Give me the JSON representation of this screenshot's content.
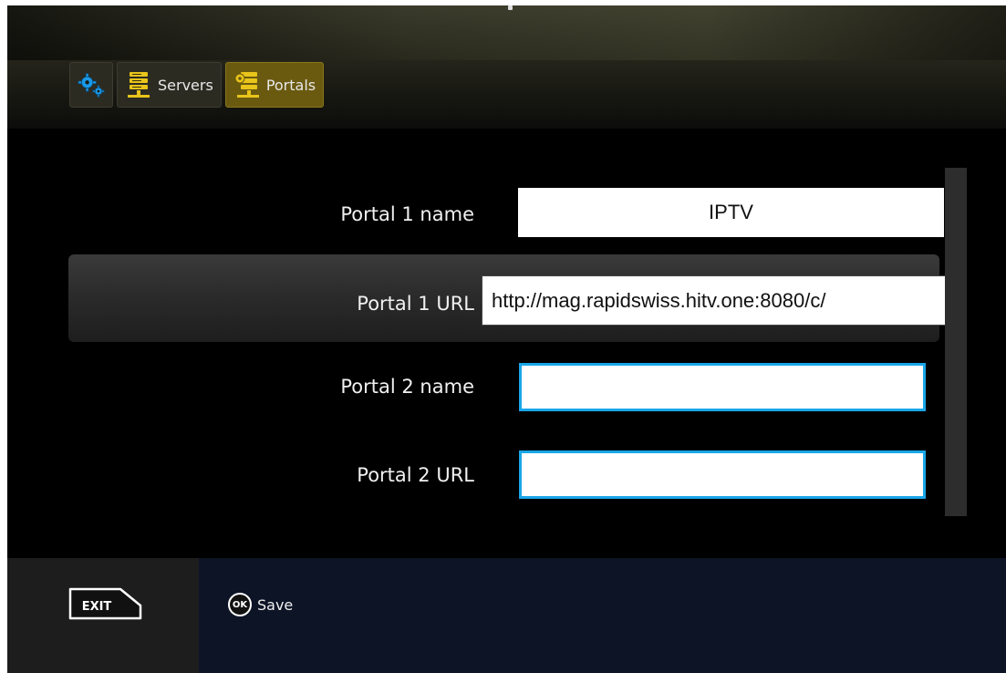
{
  "tabs": {
    "settings": {
      "icon": "gears-icon"
    },
    "servers": {
      "label": "Servers",
      "icon": "server-stack-icon"
    },
    "portals": {
      "label": "Portals",
      "icon": "portal-server-icon"
    }
  },
  "form": {
    "portal1_name": {
      "label": "Portal 1 name",
      "value": "IPTV"
    },
    "portal1_url": {
      "label": "Portal 1 URL",
      "value": "http://mag.rapidswiss.hitv.one:8080/c/"
    },
    "portal2_name": {
      "label": "Portal 2 name",
      "value": ""
    },
    "portal2_url": {
      "label": "Portal 2 URL",
      "value": ""
    }
  },
  "footer": {
    "exit_label": "EXIT",
    "ok_label": "OK",
    "save_label": "Save"
  },
  "colors": {
    "active_tab": "#6a5a10",
    "input_focus_border": "#1aa6e8",
    "icon_yellow": "#e9c41a",
    "icon_blue": "#1a9ae8"
  }
}
